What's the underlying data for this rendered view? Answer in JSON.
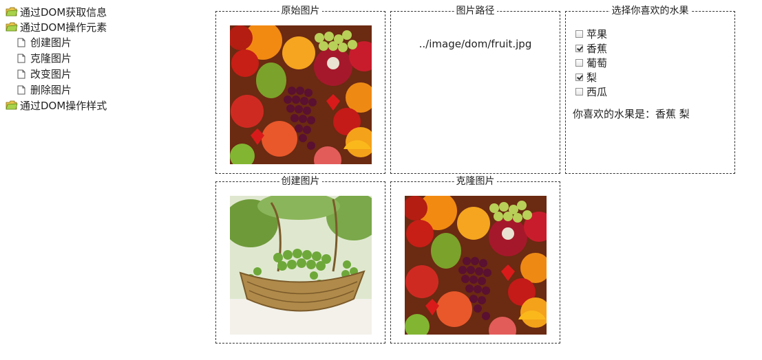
{
  "tree": {
    "nodes": [
      {
        "label": "通过DOM获取信息",
        "icon": "folder-icon"
      },
      {
        "label": "通过DOM操作元素",
        "icon": "folder-open-icon",
        "children": [
          {
            "label": "创建图片",
            "icon": "document-icon"
          },
          {
            "label": "克隆图片",
            "icon": "document-icon"
          },
          {
            "label": "改变图片",
            "icon": "document-icon"
          },
          {
            "label": "删除图片",
            "icon": "document-icon"
          }
        ]
      },
      {
        "label": "通过DOM操作样式",
        "icon": "folder-icon"
      }
    ]
  },
  "panels": {
    "original": {
      "legend": "原始图片",
      "image": "fruit-image"
    },
    "path": {
      "legend": "图片路径",
      "text": "../image/dom/fruit.jpg"
    },
    "fruits": {
      "legend": "选择你喜欢的水果",
      "options": [
        {
          "label": "苹果",
          "checked": false
        },
        {
          "label": "香蕉",
          "checked": true
        },
        {
          "label": "葡萄",
          "checked": false
        },
        {
          "label": "梨",
          "checked": true
        },
        {
          "label": "西瓜",
          "checked": false
        }
      ],
      "result_prefix": "你喜欢的水果是：",
      "result_value": "香蕉 梨"
    },
    "created": {
      "legend": "创建图片",
      "image": "grape-basket-image"
    },
    "cloned": {
      "legend": "克隆图片",
      "image": "fruit-image"
    }
  },
  "colors": {
    "border": "#333333",
    "folder": "#9fcf3a",
    "folder_dark": "#d7a92b"
  }
}
